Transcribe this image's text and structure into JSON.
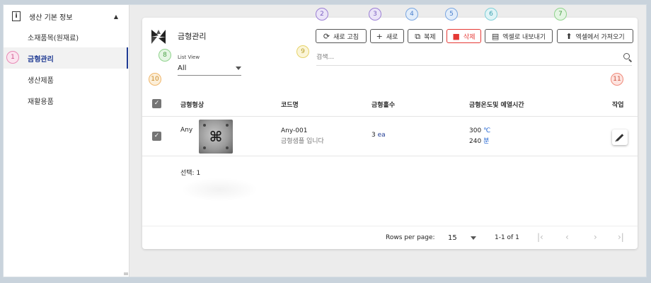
{
  "sidebar": {
    "header": {
      "title": "생산 기본 정보"
    },
    "items": [
      {
        "label": "소재품목(원재료)"
      },
      {
        "label": "금형관리",
        "active": true
      },
      {
        "label": "생산제품"
      },
      {
        "label": "재활용품"
      }
    ]
  },
  "page": {
    "title": "금형관리"
  },
  "toolbar": {
    "refresh_label": "새로 고침",
    "new_label": "새로",
    "copy_label": "복제",
    "delete_label": "삭제",
    "export_label": "엑셀로 내보내기",
    "import_label": "엑셀에서 가져오기"
  },
  "list_view": {
    "label": "List View",
    "value": "All"
  },
  "search": {
    "placeholder": "검색..."
  },
  "table": {
    "columns": [
      "금형형상",
      "코드명",
      "금형홀수",
      "금형온도및 예열시간",
      "작업"
    ],
    "rows": [
      {
        "shape": "Any",
        "code": "Any-001",
        "description": "금형샘플 입니다",
        "holes": "3",
        "holes_unit": "ea",
        "temperature": "300",
        "temperature_unit": "℃",
        "preheat": "240",
        "preheat_unit": "분",
        "checked": true
      }
    ]
  },
  "selection": {
    "text": "선택: 1"
  },
  "pagination": {
    "rows_per_page_label": "Rows per page:",
    "rows_per_page_value": "15",
    "range": "1-1 of 1"
  },
  "annotations": [
    "1",
    "2",
    "3",
    "4",
    "5",
    "6",
    "7",
    "8",
    "9",
    "10",
    "11"
  ],
  "colors": {
    "primary": "#1f3a93",
    "danger": "#e53935",
    "badge_pink": "#e88ab6",
    "badge_purple": "#9b7fd4",
    "badge_blue": "#7aa6e0",
    "badge_green": "#8fd38c",
    "badge_yellow": "#e6d36a",
    "badge_orange": "#f0b66a",
    "badge_red": "#f08a7a"
  }
}
